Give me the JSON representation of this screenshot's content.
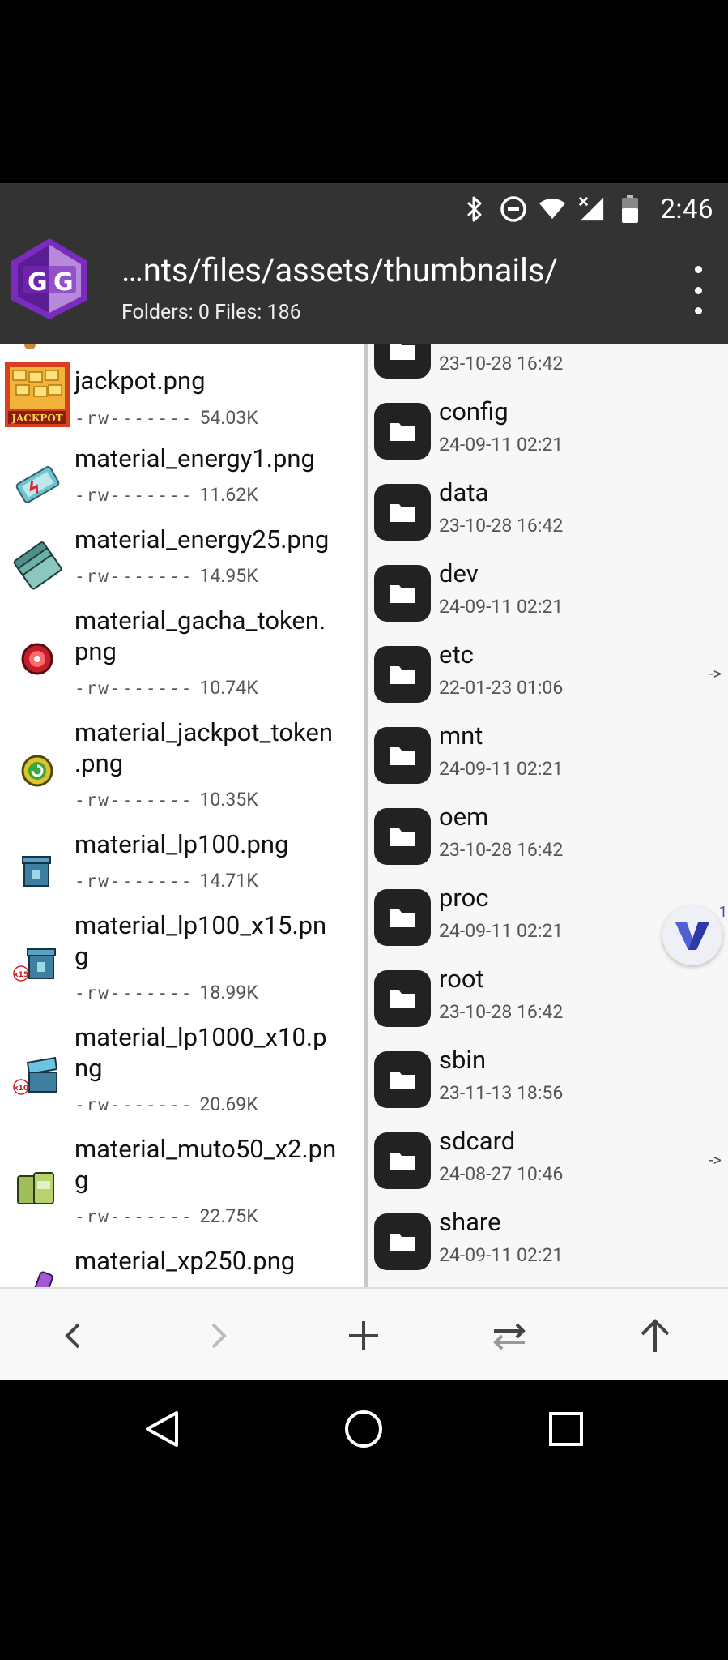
{
  "status_bar": {
    "time": "2:46",
    "icons": [
      "bluetooth-icon",
      "do-not-disturb-icon",
      "wifi-icon",
      "cell-signal-no-data-icon",
      "battery-icon"
    ]
  },
  "app_bar": {
    "path": "…nts/files/assets/thumbnails/",
    "summary": "Folders: 0  Files: 186",
    "logo_letters": "GG"
  },
  "left_files": [
    {
      "name_lines": [
        "jackpot.png"
      ],
      "perm": "-rw-------",
      "size": "54.03K",
      "thumb": "jackpot-thumb-icon",
      "thumb_label": "JACKPOT"
    },
    {
      "name_lines": [
        "material_energy1.png"
      ],
      "perm": "-rw-------",
      "size": "11.62K",
      "thumb": "energy-ticket-icon"
    },
    {
      "name_lines": [
        "material_energy25.png"
      ],
      "perm": "-rw-------",
      "size": "14.95K",
      "thumb": "energy-stack-icon"
    },
    {
      "name_lines": [
        "material_gacha_token.",
        "png"
      ],
      "perm": "-rw-------",
      "size": "10.74K",
      "thumb": "gacha-token-icon"
    },
    {
      "name_lines": [
        "material_jackpot_token",
        ".png"
      ],
      "perm": "-rw-------",
      "size": "10.35K",
      "thumb": "jackpot-token-icon"
    },
    {
      "name_lines": [
        "material_lp100.png"
      ],
      "perm": "-rw-------",
      "size": "14.71K",
      "thumb": "lp-box-icon"
    },
    {
      "name_lines": [
        "material_lp100_x15.pn",
        "g"
      ],
      "perm": "-rw-------",
      "size": "18.99K",
      "thumb": "lp-box-x15-icon",
      "thumb_label": "x15"
    },
    {
      "name_lines": [
        "material_lp1000_x10.p",
        "ng"
      ],
      "perm": "-rw-------",
      "size": "20.69K",
      "thumb": "lp-chest-x10-icon",
      "thumb_label": "x10"
    },
    {
      "name_lines": [
        "material_muto50_x2.pn",
        "g"
      ],
      "perm": "-rw-------",
      "size": "22.75K",
      "thumb": "muto-cans-icon"
    },
    {
      "name_lines": [
        "material_xp250.png"
      ],
      "perm": "",
      "size": "",
      "thumb": "xp-potion-icon"
    }
  ],
  "right_dirs": [
    {
      "name": "",
      "date": "23-10-28 16:42",
      "link": ""
    },
    {
      "name": "config",
      "date": "24-09-11 02:21",
      "link": ""
    },
    {
      "name": "data",
      "date": "23-10-28 16:42",
      "link": ""
    },
    {
      "name": "dev",
      "date": "24-09-11 02:21",
      "link": ""
    },
    {
      "name": "etc",
      "date": "22-01-23 01:06",
      "link": "->"
    },
    {
      "name": "mnt",
      "date": "24-09-11 02:21",
      "link": ""
    },
    {
      "name": "oem",
      "date": "23-10-28 16:42",
      "link": ""
    },
    {
      "name": "proc",
      "date": "24-09-11 02:21",
      "link": ""
    },
    {
      "name": "root",
      "date": "23-10-28 16:42",
      "link": ""
    },
    {
      "name": "sbin",
      "date": "23-11-13 18:56",
      "link": ""
    },
    {
      "name": "sdcard",
      "date": "24-08-27 10:46",
      "link": "->"
    },
    {
      "name": "share",
      "date": "24-09-11 02:21",
      "link": ""
    }
  ],
  "floating_badge": {
    "count": "1",
    "icon": "v-app-icon"
  },
  "toolbar": {
    "buttons": [
      "back-arrow-icon",
      "forward-arrow-icon",
      "add-icon",
      "swap-panes-icon",
      "up-directory-icon"
    ]
  },
  "nav_bar": {
    "buttons": [
      "nav-back-icon",
      "nav-home-icon",
      "nav-recents-icon"
    ]
  },
  "colors": {
    "app_bar": "#333333",
    "left_bg": "#ffffff",
    "right_bg": "#f7f7f7",
    "folder_icon": "#222222",
    "logo_purple": "#7b2cbf"
  }
}
